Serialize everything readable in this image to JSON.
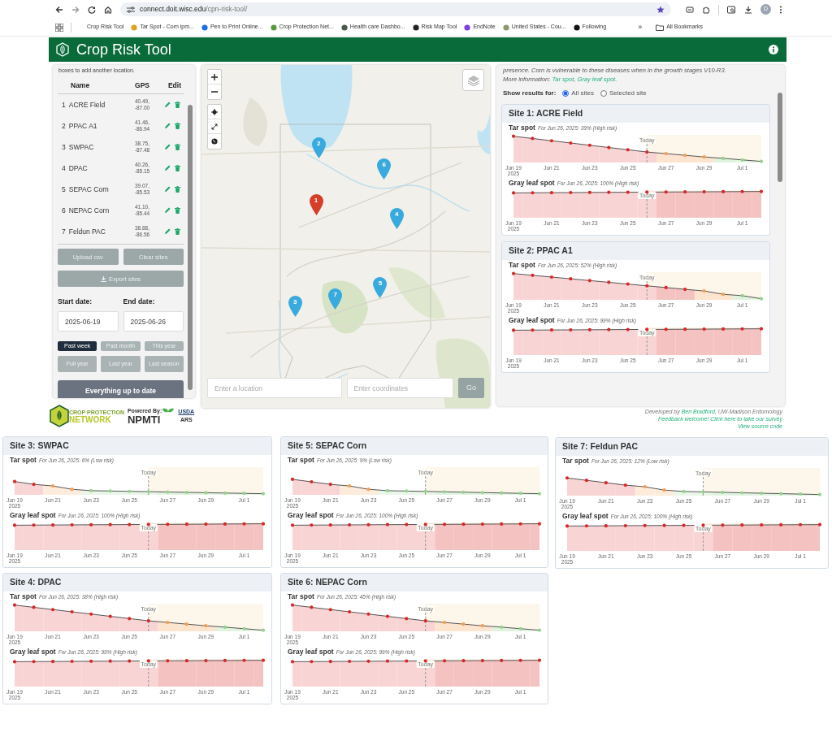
{
  "browser": {
    "url_host": "connect.doit.wisc.edu",
    "url_path": "/cpn-risk-tool/",
    "avatar": "D",
    "bookmarks": [
      {
        "label": "Crop Risk Tool"
      },
      {
        "label": "Tar Spot - Corn ipm...",
        "color": "#e0a020"
      },
      {
        "label": "Pen to Print Online...",
        "color": "#1d6fe0"
      },
      {
        "label": "Crop Protection Net...",
        "color": "#5a9a3a"
      },
      {
        "label": "Health care Dashbo...",
        "color": "#4a5a4a"
      },
      {
        "label": "Risk Map Tool",
        "color": "#222222"
      },
      {
        "label": "EndNote",
        "color": "#7b3fe4"
      },
      {
        "label": "United States - Cou...",
        "color": "#8a9a6a"
      },
      {
        "label": "Following",
        "color": "#111111"
      }
    ],
    "more": "»",
    "all_bookmarks": "All Bookmarks"
  },
  "header": {
    "title": "Crop Risk Tool"
  },
  "sidebar": {
    "intro": "boxes to add another location.",
    "columns": [
      "Name",
      "GPS",
      "Edit"
    ],
    "sites": [
      {
        "number": "1",
        "name": "ACRE Field",
        "lat": "40.49,",
        "lon": "-87.00"
      },
      {
        "number": "2",
        "name": "PPAC A1",
        "lat": "41.46,",
        "lon": "-86.94"
      },
      {
        "number": "3",
        "name": "SWPAC",
        "lat": "38.75,",
        "lon": "-87.48"
      },
      {
        "number": "4",
        "name": "DPAC",
        "lat": "40.26,",
        "lon": "-85.15"
      },
      {
        "number": "5",
        "name": "SEPAC Corn",
        "lat": "39.07,",
        "lon": "-85.53"
      },
      {
        "number": "6",
        "name": "NEPAC Corn",
        "lat": "41.10,",
        "lon": "-85.44"
      },
      {
        "number": "7",
        "name": "Feldun PAC",
        "lat": "38.88,",
        "lon": "-86.56"
      }
    ],
    "upload": "Upload csv",
    "clear": "Clear sites",
    "export": "Export sites",
    "start_date": {
      "label": "Start date:",
      "value": "2025-06-19"
    },
    "end_date": {
      "label": "End date:",
      "value": "2025-06-26"
    },
    "ranges": [
      {
        "label": "Past week",
        "selected": true
      },
      {
        "label": "Past month",
        "selected": false
      },
      {
        "label": "This year",
        "selected": false
      },
      {
        "label": "Full year",
        "selected": false
      },
      {
        "label": "Last year",
        "selected": false
      },
      {
        "label": "Last season",
        "selected": false
      }
    ],
    "status_button": "Everything up to date"
  },
  "logos": {
    "cpn_top": "CROP PROTECTION",
    "cpn_bottom": "NETWORK",
    "powered_by": "Powered By:",
    "npmti": "NPMTI",
    "usda": "USDA",
    "ars": "ARS"
  },
  "map": {
    "markers": [
      {
        "label": "1",
        "selected": true
      },
      {
        "label": "2",
        "selected": false
      },
      {
        "label": "3",
        "selected": false
      },
      {
        "label": "4",
        "selected": false
      },
      {
        "label": "5",
        "selected": false
      },
      {
        "label": "6",
        "selected": false
      },
      {
        "label": "7",
        "selected": false
      }
    ],
    "location_placeholder": "Enter a location",
    "coords_placeholder": "Enter coordinates",
    "go": "Go"
  },
  "results": {
    "intro": "presence. Corn is vulnerable to these diseases when in the growth stages V10-R3.",
    "more_prefix": "More information: ",
    "links": [
      "Tar spot",
      "Gray leaf spot"
    ],
    "link_separator": ", ",
    "more_suffix": ".",
    "show_label": "Show results for:",
    "options": [
      {
        "label": "All sites",
        "selected": true
      },
      {
        "label": "Selected site",
        "selected": false
      }
    ],
    "sites": [
      {
        "title": "Site 1: ACRE Field",
        "charts": [
          {
            "disease": "Tar spot",
            "summary": "For Jun 26, 2025: 39% (High risk)",
            "today": "Today",
            "x_labels": [
              "Jun 19",
              "Jun 21",
              "Jun 23",
              "Jun 25",
              "Jun 27",
              "Jun 29",
              "Jul 1"
            ],
            "year": "2025",
            "points": [
              {
                "color": "#dc2626"
              },
              {
                "color": "#dc2626"
              },
              {
                "color": "#dc2626"
              },
              {
                "color": "#dc2626"
              },
              {
                "color": "#dc2626"
              },
              {
                "color": "#dc2626"
              },
              {
                "color": "#dc2626"
              },
              {
                "color": "#dc2626"
              },
              {
                "color": "#f59e52"
              },
              {
                "color": "#f59e52"
              },
              {
                "color": "#f59e52"
              },
              {
                "color": "#93d38c"
              },
              {
                "color": "#93d38c"
              },
              {
                "color": "#93d38c"
              }
            ]
          },
          {
            "disease": "Gray leaf spot",
            "summary": "For Jun 26, 2025: 100% (High risk)",
            "today": "Today",
            "x_labels": [
              "Jun 19",
              "Jun 21",
              "Jun 23",
              "Jun 25",
              "Jun 27",
              "Jun 29",
              "Jul 1"
            ],
            "year": "2025",
            "points": [
              {
                "color": "#dc2626"
              },
              {
                "color": "#dc2626"
              },
              {
                "color": "#dc2626"
              },
              {
                "color": "#dc2626"
              },
              {
                "color": "#dc2626"
              },
              {
                "color": "#dc2626"
              },
              {
                "color": "#dc2626"
              },
              {
                "color": "#dc2626"
              },
              {
                "color": "#dc2626"
              },
              {
                "color": "#dc2626"
              },
              {
                "color": "#dc2626"
              },
              {
                "color": "#dc2626"
              },
              {
                "color": "#dc2626"
              },
              {
                "color": "#dc2626"
              }
            ]
          }
        ]
      },
      {
        "title": "Site 2: PPAC A1",
        "charts": [
          {
            "disease": "Tar spot",
            "summary": "For Jun 26, 2025: 52% (High risk)",
            "today": "Today",
            "x_labels": [
              "Jun 19",
              "Jun 21",
              "Jun 23",
              "Jun 25",
              "Jun 27",
              "Jun 29",
              "Jul 1"
            ],
            "year": "2025",
            "points": [
              {
                "color": "#dc2626"
              },
              {
                "color": "#dc2626"
              },
              {
                "color": "#dc2626"
              },
              {
                "color": "#dc2626"
              },
              {
                "color": "#dc2626"
              },
              {
                "color": "#dc2626"
              },
              {
                "color": "#dc2626"
              },
              {
                "color": "#dc2626"
              },
              {
                "color": "#dc2626"
              },
              {
                "color": "#dc2626"
              },
              {
                "color": "#f59e52"
              },
              {
                "color": "#f59e52"
              },
              {
                "color": "#93d38c"
              },
              {
                "color": "#93d38c"
              }
            ]
          },
          {
            "disease": "Gray leaf spot",
            "summary": "For Jun 26, 2025: 99% (High risk)",
            "today": "Today",
            "x_labels": [
              "Jun 19",
              "Jun 21",
              "Jun 23",
              "Jun 25",
              "Jun 27",
              "Jun 29",
              "Jul 1"
            ],
            "year": "2025",
            "points": [
              {
                "color": "#dc2626"
              },
              {
                "color": "#dc2626"
              },
              {
                "color": "#dc2626"
              },
              {
                "color": "#dc2626"
              },
              {
                "color": "#dc2626"
              },
              {
                "color": "#dc2626"
              },
              {
                "color": "#dc2626"
              },
              {
                "color": "#dc2626"
              },
              {
                "color": "#dc2626"
              },
              {
                "color": "#dc2626"
              },
              {
                "color": "#dc2626"
              },
              {
                "color": "#dc2626"
              },
              {
                "color": "#dc2626"
              },
              {
                "color": "#dc2626"
              }
            ]
          }
        ]
      }
    ]
  },
  "credits": {
    "developed_prefix": "Developed by ",
    "author": "Ben Bradford",
    "developed_suffix": ", UW-Madison Entomology",
    "feedback": "Feedback welcome! Click here to take our survey",
    "source": "View source code"
  },
  "collage": {
    "columns": [
      [
        {
          "title": "Site 3: SWPAC",
          "charts": [
            {
              "disease": "Tar spot",
              "summary": "For Jun 26, 2025: 6% (Low risk)",
              "today": "Today",
              "x_labels": [
                "Jun 19",
                "Jun 21",
                "Jun 23",
                "Jun 25",
                "Jun 27",
                "Jun 29",
                "Jul 1"
              ],
              "year": "2025",
              "points": [
                {
                  "color": "#dc2626"
                },
                {
                  "color": "#dc2626"
                },
                {
                  "color": "#f59e52"
                },
                {
                  "color": "#f59e52"
                },
                {
                  "color": "#93d38c"
                },
                {
                  "color": "#93d38c"
                },
                {
                  "color": "#93d38c"
                },
                {
                  "color": "#93d38c"
                },
                {
                  "color": "#93d38c"
                },
                {
                  "color": "#93d38c"
                },
                {
                  "color": "#93d38c"
                },
                {
                  "color": "#93d38c"
                },
                {
                  "color": "#93d38c"
                },
                {
                  "color": "#93d38c"
                }
              ]
            },
            {
              "disease": "Gray leaf spot",
              "summary": "For Jun 26, 2025: 100% (High risk)",
              "today": "Today",
              "x_labels": [
                "Jun 19",
                "Jun 21",
                "Jun 23",
                "Jun 25",
                "Jun 27",
                "Jun 29",
                "Jul 1"
              ],
              "year": "2025",
              "points": [
                {
                  "color": "#dc2626"
                },
                {
                  "color": "#dc2626"
                },
                {
                  "color": "#dc2626"
                },
                {
                  "color": "#dc2626"
                },
                {
                  "color": "#dc2626"
                },
                {
                  "color": "#dc2626"
                },
                {
                  "color": "#dc2626"
                },
                {
                  "color": "#dc2626"
                },
                {
                  "color": "#dc2626"
                },
                {
                  "color": "#dc2626"
                },
                {
                  "color": "#dc2626"
                },
                {
                  "color": "#dc2626"
                },
                {
                  "color": "#dc2626"
                },
                {
                  "color": "#dc2626"
                }
              ]
            }
          ]
        },
        {
          "title": "Site 4: DPAC",
          "charts": [
            {
              "disease": "Tar spot",
              "summary": "For Jun 26, 2025: 38% (High risk)",
              "today": "Today",
              "x_labels": [
                "Jun 19",
                "Jun 21",
                "Jun 23",
                "Jun 25",
                "Jun 27",
                "Jun 29",
                "Jul 1"
              ],
              "year": "2025",
              "points": [
                {
                  "color": "#dc2626"
                },
                {
                  "color": "#dc2626"
                },
                {
                  "color": "#dc2626"
                },
                {
                  "color": "#dc2626"
                },
                {
                  "color": "#dc2626"
                },
                {
                  "color": "#dc2626"
                },
                {
                  "color": "#dc2626"
                },
                {
                  "color": "#dc2626"
                },
                {
                  "color": "#f59e52"
                },
                {
                  "color": "#f59e52"
                },
                {
                  "color": "#f59e52"
                },
                {
                  "color": "#93d38c"
                },
                {
                  "color": "#93d38c"
                },
                {
                  "color": "#93d38c"
                }
              ]
            },
            {
              "disease": "Gray leaf spot",
              "summary": "For Jun 26, 2025: 99% (High risk)",
              "today": "Today",
              "x_labels": [
                "Jun 19",
                "Jun 21",
                "Jun 23",
                "Jun 25",
                "Jun 27",
                "Jun 29",
                "Jul 1"
              ],
              "year": "2025",
              "points": [
                {
                  "color": "#dc2626"
                },
                {
                  "color": "#dc2626"
                },
                {
                  "color": "#dc2626"
                },
                {
                  "color": "#dc2626"
                },
                {
                  "color": "#dc2626"
                },
                {
                  "color": "#dc2626"
                },
                {
                  "color": "#dc2626"
                },
                {
                  "color": "#dc2626"
                },
                {
                  "color": "#dc2626"
                },
                {
                  "color": "#dc2626"
                },
                {
                  "color": "#dc2626"
                },
                {
                  "color": "#dc2626"
                },
                {
                  "color": "#dc2626"
                },
                {
                  "color": "#dc2626"
                }
              ]
            }
          ]
        }
      ],
      [
        {
          "title": "Site 5: SEPAC Corn",
          "charts": [
            {
              "disease": "Tar spot",
              "summary": "For Jun 26, 2025: 9% (Low risk)",
              "today": "Today",
              "x_labels": [
                "Jun 19",
                "Jun 21",
                "Jun 23",
                "Jun 25",
                "Jun 27",
                "Jun 29",
                "Jul 1"
              ],
              "year": "2025",
              "points": [
                {
                  "color": "#dc2626"
                },
                {
                  "color": "#dc2626"
                },
                {
                  "color": "#dc2626"
                },
                {
                  "color": "#f59e52"
                },
                {
                  "color": "#f59e52"
                },
                {
                  "color": "#93d38c"
                },
                {
                  "color": "#93d38c"
                },
                {
                  "color": "#93d38c"
                },
                {
                  "color": "#93d38c"
                },
                {
                  "color": "#93d38c"
                },
                {
                  "color": "#93d38c"
                },
                {
                  "color": "#93d38c"
                },
                {
                  "color": "#93d38c"
                },
                {
                  "color": "#93d38c"
                }
              ]
            },
            {
              "disease": "Gray leaf spot",
              "summary": "For Jun 26, 2025: 100% (High risk)",
              "today": "Today",
              "x_labels": [
                "Jun 19",
                "Jun 21",
                "Jun 23",
                "Jun 25",
                "Jun 27",
                "Jun 29",
                "Jul 1"
              ],
              "year": "2025",
              "points": [
                {
                  "color": "#dc2626"
                },
                {
                  "color": "#dc2626"
                },
                {
                  "color": "#dc2626"
                },
                {
                  "color": "#dc2626"
                },
                {
                  "color": "#dc2626"
                },
                {
                  "color": "#dc2626"
                },
                {
                  "color": "#dc2626"
                },
                {
                  "color": "#dc2626"
                },
                {
                  "color": "#dc2626"
                },
                {
                  "color": "#dc2626"
                },
                {
                  "color": "#dc2626"
                },
                {
                  "color": "#dc2626"
                },
                {
                  "color": "#dc2626"
                },
                {
                  "color": "#dc2626"
                }
              ]
            }
          ]
        },
        {
          "title": "Site 6: NEPAC Corn",
          "charts": [
            {
              "disease": "Tar spot",
              "summary": "For Jun 26, 2025: 45% (High risk)",
              "today": "Today",
              "x_labels": [
                "Jun 19",
                "Jun 21",
                "Jun 23",
                "Jun 25",
                "Jun 27",
                "Jun 29",
                "Jul 1"
              ],
              "year": "2025",
              "points": [
                {
                  "color": "#dc2626"
                },
                {
                  "color": "#dc2626"
                },
                {
                  "color": "#dc2626"
                },
                {
                  "color": "#dc2626"
                },
                {
                  "color": "#dc2626"
                },
                {
                  "color": "#dc2626"
                },
                {
                  "color": "#dc2626"
                },
                {
                  "color": "#dc2626"
                },
                {
                  "color": "#f59e52"
                },
                {
                  "color": "#f59e52"
                },
                {
                  "color": "#f59e52"
                },
                {
                  "color": "#93d38c"
                },
                {
                  "color": "#93d38c"
                },
                {
                  "color": "#93d38c"
                }
              ]
            },
            {
              "disease": "Gray leaf spot",
              "summary": "For Jun 26, 2025: 99% (High risk)",
              "today": "Today",
              "x_labels": [
                "Jun 19",
                "Jun 21",
                "Jun 23",
                "Jun 25",
                "Jun 27",
                "Jun 29",
                "Jul 1"
              ],
              "year": "2025",
              "points": [
                {
                  "color": "#dc2626"
                },
                {
                  "color": "#dc2626"
                },
                {
                  "color": "#dc2626"
                },
                {
                  "color": "#dc2626"
                },
                {
                  "color": "#dc2626"
                },
                {
                  "color": "#dc2626"
                },
                {
                  "color": "#dc2626"
                },
                {
                  "color": "#dc2626"
                },
                {
                  "color": "#dc2626"
                },
                {
                  "color": "#dc2626"
                },
                {
                  "color": "#dc2626"
                },
                {
                  "color": "#dc2626"
                },
                {
                  "color": "#dc2626"
                },
                {
                  "color": "#dc2626"
                }
              ]
            }
          ]
        }
      ],
      [
        {
          "title": "Site 7: Feldun PAC",
          "charts": [
            {
              "disease": "Tar spot",
              "summary": "For Jun 26, 2025: 12% (Low risk)",
              "today": "Today",
              "x_labels": [
                "Jun 19",
                "Jun 21",
                "Jun 23",
                "Jun 25",
                "Jun 27",
                "Jun 29",
                "Jul 1"
              ],
              "year": "2025",
              "points": [
                {
                  "color": "#dc2626"
                },
                {
                  "color": "#dc2626"
                },
                {
                  "color": "#dc2626"
                },
                {
                  "color": "#dc2626"
                },
                {
                  "color": "#f59e52"
                },
                {
                  "color": "#f59e52"
                },
                {
                  "color": "#93d38c"
                },
                {
                  "color": "#93d38c"
                },
                {
                  "color": "#93d38c"
                },
                {
                  "color": "#93d38c"
                },
                {
                  "color": "#93d38c"
                },
                {
                  "color": "#93d38c"
                },
                {
                  "color": "#93d38c"
                },
                {
                  "color": "#93d38c"
                }
              ]
            },
            {
              "disease": "Gray leaf spot",
              "summary": "For Jun 26, 2025: 100% (High risk)",
              "today": "Today",
              "x_labels": [
                "Jun 19",
                "Jun 21",
                "Jun 23",
                "Jun 25",
                "Jun 27",
                "Jun 29",
                "Jul 1"
              ],
              "year": "2025",
              "points": [
                {
                  "color": "#dc2626"
                },
                {
                  "color": "#dc2626"
                },
                {
                  "color": "#dc2626"
                },
                {
                  "color": "#dc2626"
                },
                {
                  "color": "#dc2626"
                },
                {
                  "color": "#dc2626"
                },
                {
                  "color": "#dc2626"
                },
                {
                  "color": "#dc2626"
                },
                {
                  "color": "#dc2626"
                },
                {
                  "color": "#dc2626"
                },
                {
                  "color": "#dc2626"
                },
                {
                  "color": "#dc2626"
                },
                {
                  "color": "#dc2626"
                },
                {
                  "color": "#dc2626"
                }
              ]
            }
          ]
        }
      ]
    ]
  }
}
